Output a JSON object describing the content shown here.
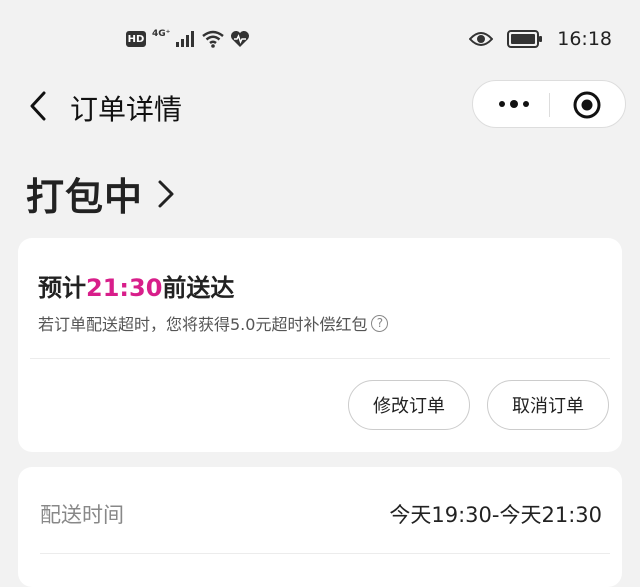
{
  "status_bar": {
    "hd": "HD",
    "network": "4G⁺",
    "time": "16:18",
    "icons": [
      "signal-icon",
      "wifi-icon",
      "heart-icon",
      "eye-icon",
      "battery-icon"
    ]
  },
  "nav": {
    "title": "订单详情"
  },
  "order": {
    "status": "打包中",
    "eta_prefix": "预计",
    "eta_time": "21:30",
    "eta_suffix": "前送达",
    "compensation": "若订单配送超时，您将获得5.0元超时补偿红包",
    "help_symbol": "?",
    "modify_label": "修改订单",
    "cancel_label": "取消订单"
  },
  "delivery": {
    "label": "配送时间",
    "value": "今天19:30-今天21:30"
  },
  "colors": {
    "accent": "#d81e8a",
    "background": "#f2f2f2",
    "card": "#ffffff"
  }
}
